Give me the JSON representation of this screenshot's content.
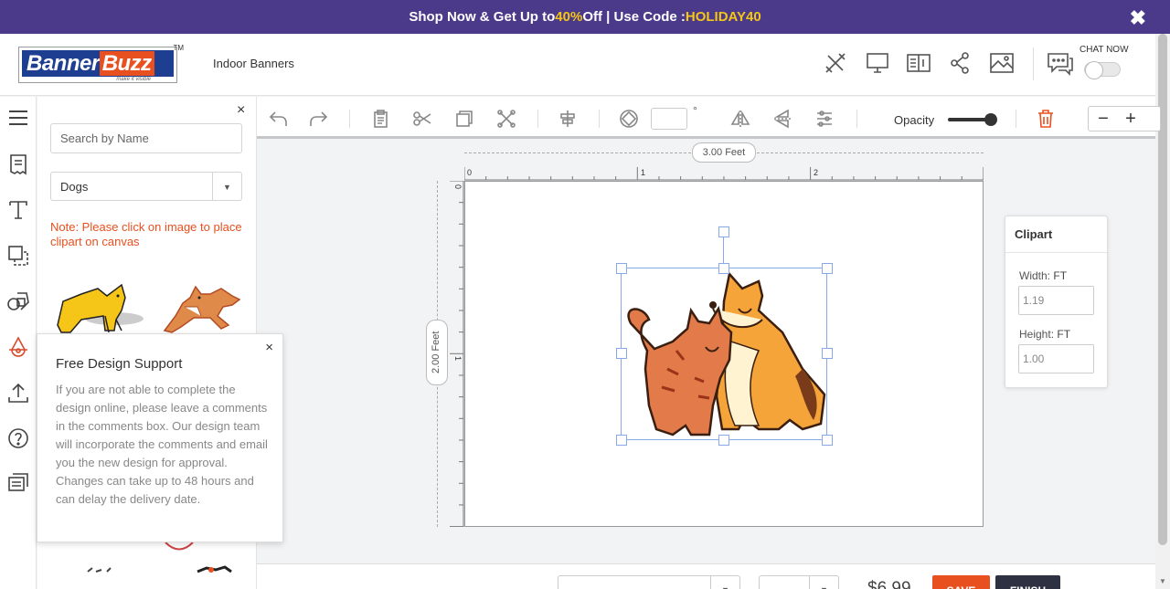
{
  "promo": {
    "prefix": "Shop Now & Get Up to ",
    "percent": "40%",
    "middle": " Off | Use Code : ",
    "code": "HOLIDAY40",
    "close": "✖"
  },
  "header": {
    "logo_banner": "Banner",
    "logo_buzz": "Buzz",
    "logo_tagline": "make it visible",
    "logo_tm": "TM",
    "product": "Indoor Banners",
    "chat_label": "CHAT NOW"
  },
  "panel": {
    "close": "×",
    "search_placeholder": "Search by Name",
    "category": "Dogs",
    "note": "Note: Please click on image to place clipart on canvas"
  },
  "support": {
    "close": "×",
    "title": "Free Design Support",
    "body": "If you are not able to complete the design online, please leave a comments in the comments box. Our design team will incorporate the comments and email you the new design for approval. Changes can take up to 48 hours and can delay the delivery date."
  },
  "toolbar": {
    "angle_value": "",
    "degree": "°",
    "opacity_label": "Opacity",
    "opacity": 1.0,
    "zoom_out": "−",
    "zoom_in": "+"
  },
  "canvas": {
    "width_label": "3.00 Feet",
    "height_label": "2.00 Feet",
    "ruler_top": [
      "0",
      "1",
      "2"
    ],
    "ruler_left": [
      "0",
      "1"
    ]
  },
  "clipart_panel": {
    "title": "Clipart",
    "width_label": "Width:",
    "height_label": "Height:",
    "unit": "FT",
    "width_value": "1.19",
    "height_value": "1.00"
  },
  "bottom": {
    "price": "$6.99",
    "save": "SAVE",
    "finish": "FINISH",
    "select1": "",
    "select2": ""
  },
  "colors": {
    "promo_bg": "#4b3a8a",
    "accent": "#e8501f",
    "highlight": "#f5c518",
    "brand_blue": "#1e3f91"
  }
}
